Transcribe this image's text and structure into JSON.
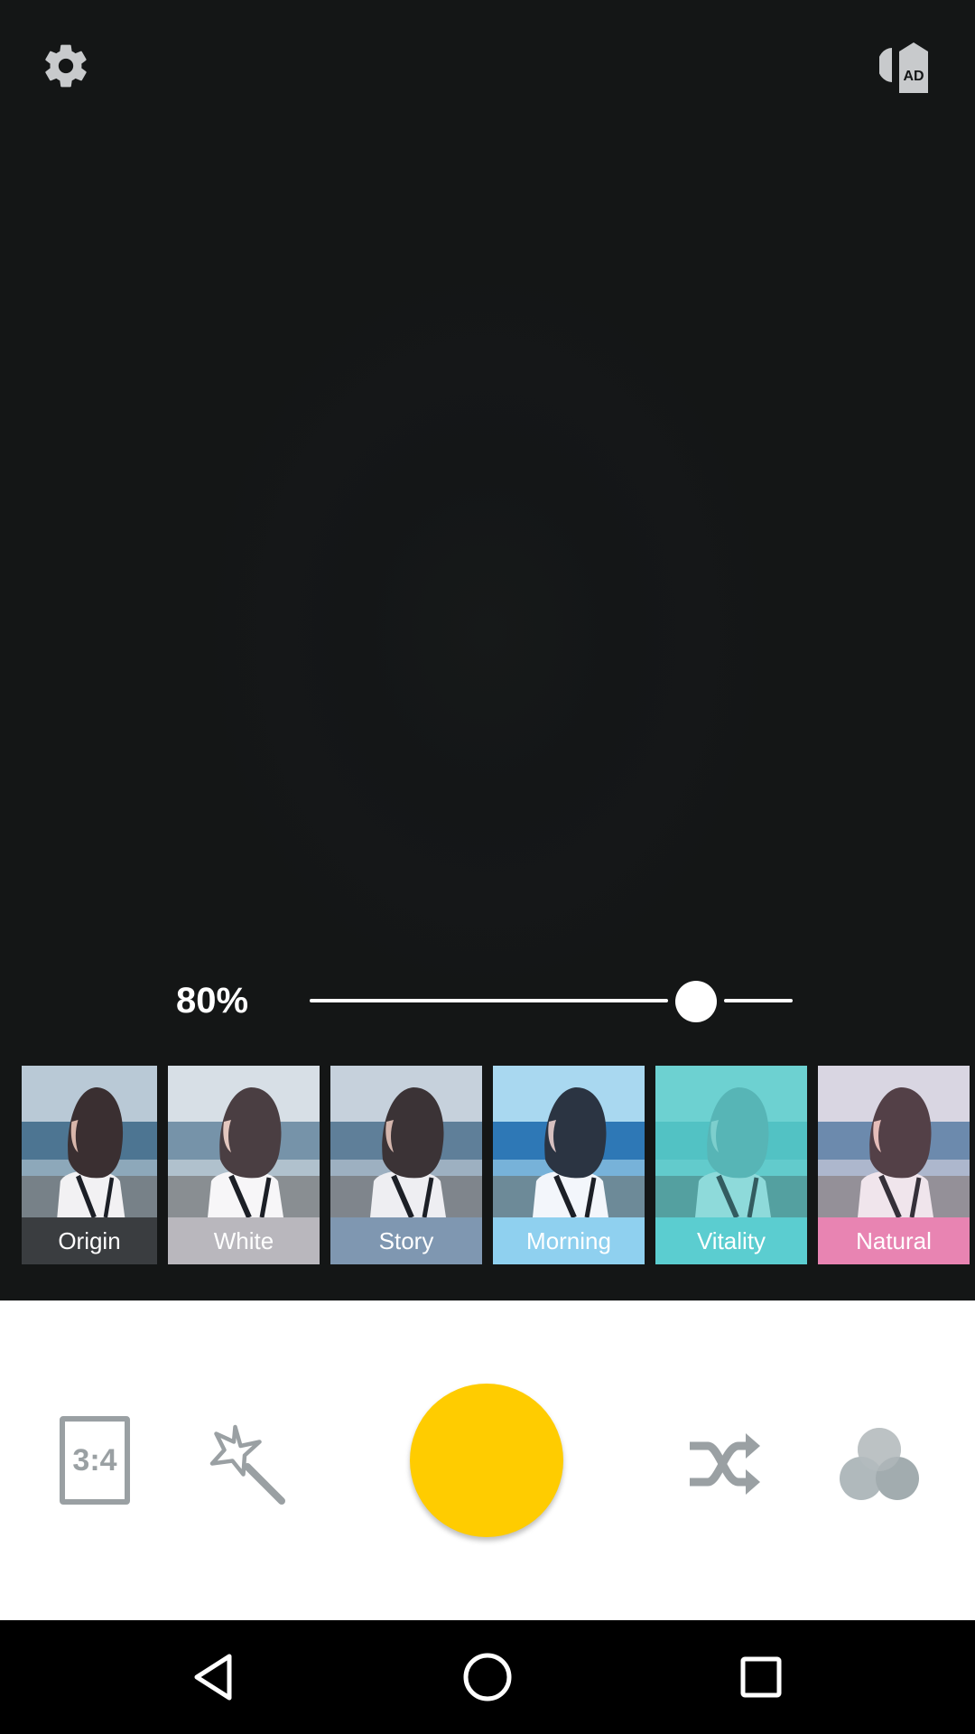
{
  "camera": {
    "settings_icon": "gear-icon",
    "ad_icon": "remove-ads-icon",
    "ad_icon_text": "AD"
  },
  "intensity": {
    "label": "80%",
    "value_fraction": 0.8
  },
  "filters": [
    {
      "label": "Origin",
      "label_bg": "#3a3d40",
      "tint": "none"
    },
    {
      "label": "White",
      "label_bg": "#b9b7bd",
      "tint": "white"
    },
    {
      "label": "Story",
      "label_bg": "#7f97b1",
      "tint": "story"
    },
    {
      "label": "Morning",
      "label_bg": "#8fd0ef",
      "tint": "morning"
    },
    {
      "label": "Vitality",
      "label_bg": "#5bcdd0",
      "tint": "vitality"
    },
    {
      "label": "Natural",
      "label_bg": "#e884b2",
      "tint": "natural"
    }
  ],
  "controls": {
    "ratio_label": "3:4",
    "magic_icon": "magic-wand-icon",
    "shutter_color": "#ffcc00",
    "shuffle_icon": "shuffle-icon",
    "filters_icon": "color-bubbles-icon"
  },
  "navbar": {
    "back_icon": "back-triangle-icon",
    "home_icon": "home-circle-icon",
    "recent_icon": "recent-square-icon"
  }
}
